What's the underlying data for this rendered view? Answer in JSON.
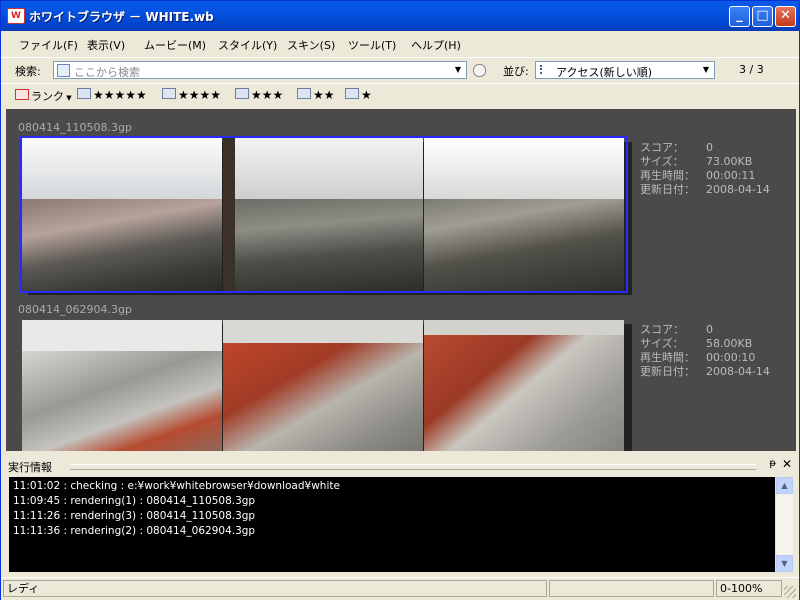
{
  "window": {
    "title": "ホワイトブラウザ － WHITE.wb",
    "app_icon": "wb-app-icon"
  },
  "menu": [
    "ファイル(F)",
    "表示(V)",
    "ムービー(M)",
    "スタイル(Y)",
    "スキン(S)",
    "ツール(T)",
    "ヘルプ(H)"
  ],
  "search": {
    "label": "検索:",
    "placeholder": "ここから検索"
  },
  "sort": {
    "label": "並び:",
    "value": "アクセス(新しい順)",
    "page": "3 / 3"
  },
  "rank": {
    "label": "ランク",
    "items": [
      "★★★★★",
      "★★★★",
      "★★★",
      "★★",
      "★"
    ]
  },
  "movies": [
    {
      "file": "080414_110508.3gp",
      "score_label": "スコア：",
      "score": "0",
      "size_label": "サイズ：",
      "size": "73.00KB",
      "duration_label": "再生時間：",
      "duration": "00:00:11",
      "date_label": "更新日付：",
      "date": "2008-04-14",
      "selected": true
    },
    {
      "file": "080414_062904.3gp",
      "score_label": "スコア：",
      "score": "0",
      "size_label": "サイズ：",
      "size": "58.00KB",
      "duration_label": "再生時間：",
      "duration": "00:00:10",
      "date_label": "更新日付：",
      "date": "2008-04-14",
      "selected": false
    }
  ],
  "log_panel": {
    "title": "実行情報",
    "lines": [
      "11:01:02 : checking : e:¥work¥whitebrowser¥download¥white",
      "11:09:45 : rendering(1) : 080414_110508.3gp",
      "11:11:26 : rendering(3) : 080414_110508.3gp",
      "11:11:36 : rendering(2) : 080414_062904.3gp"
    ]
  },
  "status": {
    "text": "レディ",
    "zoom": "0-100%"
  }
}
